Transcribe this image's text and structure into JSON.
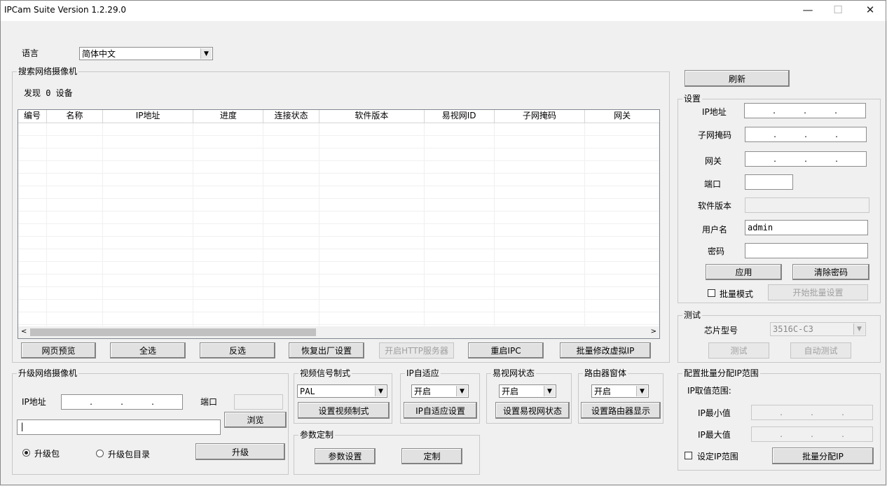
{
  "window": {
    "title": "IPCam Suite Version 1.2.29.0",
    "minimize": "—",
    "maximize": "☐",
    "close": "✕"
  },
  "language": {
    "label": "语言",
    "value": "简体中文"
  },
  "search": {
    "legend": "搜索网络摄像机",
    "found": "发现 0 设备",
    "columns": [
      "编号",
      "名称",
      "IP地址",
      "进度",
      "连接状态",
      "软件版本",
      "易视网ID",
      "子网掩码",
      "网关"
    ],
    "buttons": {
      "preview": "网页预览",
      "select_all": "全选",
      "invert": "反选",
      "factory": "恢复出厂设置",
      "http": "开启HTTP服务器",
      "reboot": "重启IPC",
      "batch_ip": "批量修改虚拟IP"
    }
  },
  "refresh": "刷新",
  "settings": {
    "legend": "设置",
    "ip_label": "IP地址",
    "mask_label": "子网掩码",
    "gateway_label": "网关",
    "port_label": "端口",
    "version_label": "软件版本",
    "user_label": "用户名",
    "user_value": "admin",
    "password_label": "密码",
    "apply": "应用",
    "clear_pwd": "清除密码",
    "batch_mode": "批量模式",
    "start_batch": "开始批量设置"
  },
  "test": {
    "legend": "测试",
    "chip_label": "芯片型号",
    "chip_value": "3516C-C3",
    "test_btn": "测试",
    "auto_test": "自动测试"
  },
  "upgrade": {
    "legend": "升级网络摄像机",
    "ip_label": "IP地址",
    "port_label": "端口",
    "browse": "浏览",
    "radio_pkg": "升级包",
    "radio_dir": "升级包目录",
    "upgrade_btn": "升级"
  },
  "video": {
    "legend": "视频信号制式",
    "value": "PAL",
    "button": "设置视频制式"
  },
  "ipadapt": {
    "legend": "IP自适应",
    "value": "开启",
    "button": "IP自适应设置"
  },
  "ysw": {
    "legend": "易视网状态",
    "value": "开启",
    "button": "设置易视网状态"
  },
  "router": {
    "legend": "路由器窗体",
    "value": "开启",
    "button": "设置路由器显示"
  },
  "params": {
    "legend": "参数定制",
    "settings": "参数设置",
    "custom": "定制"
  },
  "batchip": {
    "legend": "配置批量分配IP范围",
    "range_label": "IP取值范围:",
    "min_label": "IP最小值",
    "max_label": "IP最大值",
    "set_range": "设定IP范围",
    "assign": "批量分配IP"
  }
}
